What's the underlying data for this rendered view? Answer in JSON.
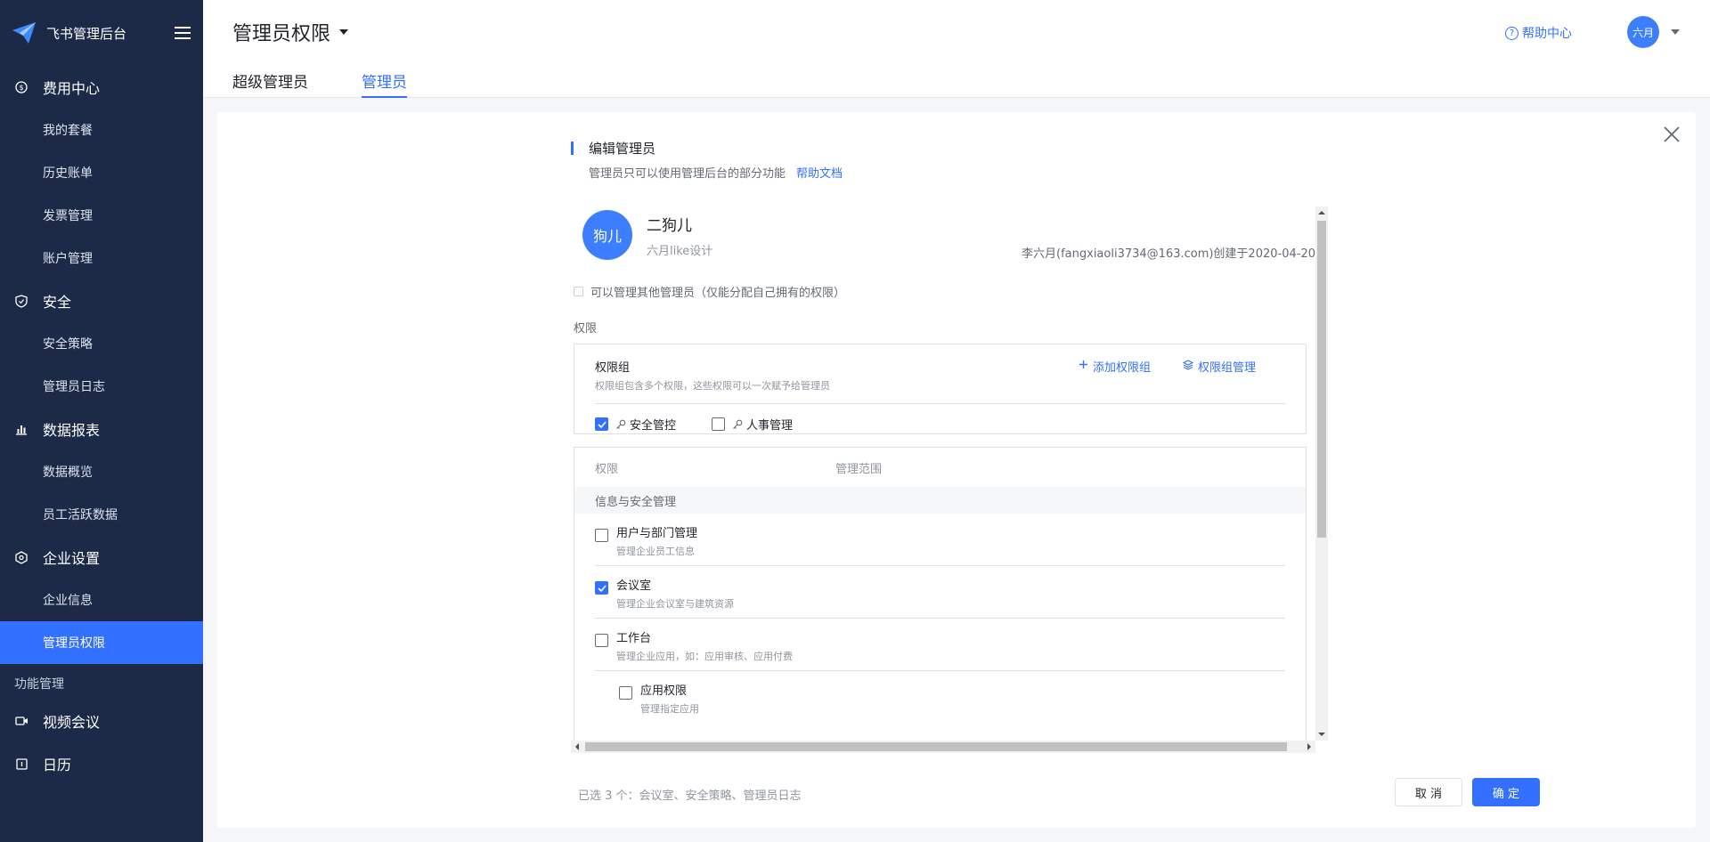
{
  "brand": {
    "name": "飞书管理后台"
  },
  "sidebar": {
    "groups": [
      {
        "label": "费用中心",
        "icon": "coin-icon",
        "items": [
          "我的套餐",
          "历史账单",
          "发票管理",
          "账户管理"
        ]
      },
      {
        "label": "安全",
        "icon": "shield-icon",
        "items": [
          "安全策略",
          "管理员日志"
        ]
      },
      {
        "label": "数据报表",
        "icon": "bar-chart-icon",
        "items": [
          "数据概览",
          "员工活跃数据"
        ]
      },
      {
        "label": "企业设置",
        "icon": "hexagon-settings-icon",
        "items": [
          "企业信息",
          "管理员权限"
        ]
      }
    ],
    "active_item": "管理员权限",
    "section_label": "功能管理",
    "feature_items": [
      {
        "label": "视频会议",
        "icon": "video-icon"
      },
      {
        "label": "日历",
        "icon": "calendar-icon"
      }
    ]
  },
  "header": {
    "title": "管理员权限",
    "tabs": [
      {
        "label": "超级管理员",
        "active": false
      },
      {
        "label": "管理员",
        "active": true
      }
    ],
    "help_label": "帮助中心",
    "user_avatar": "六月"
  },
  "editor": {
    "title": "编辑管理员",
    "description": "管理员只可以使用管理后台的部分功能",
    "help_link": "帮助文档",
    "user": {
      "avatar": "狗儿",
      "name": "二狗儿",
      "org": "六月like设计",
      "created": "李六月(fangxiaoli3734@163.com)创建于2020-04-20"
    },
    "can_manage_label": "可以管理其他管理员（仅能分配自己拥有的权限）",
    "permissions_label": "权限",
    "group": {
      "title": "权限组",
      "desc": "权限组包含多个权限，这些权限可以一次赋予给管理员",
      "add_label": "添加权限组",
      "manage_label": "权限组管理",
      "items": [
        {
          "label": "安全管控",
          "checked": true
        },
        {
          "label": "人事管理",
          "checked": false
        }
      ]
    },
    "table": {
      "col_permission": "权限",
      "col_scope": "管理范围",
      "category": "信息与安全管理",
      "rows": [
        {
          "name": "用户与部门管理",
          "desc": "管理企业员工信息",
          "checked": false
        },
        {
          "name": "会议室",
          "desc": "管理企业会议室与建筑资源",
          "checked": true
        },
        {
          "name": "工作台",
          "desc": "管理企业应用，如：应用审核、应用付费",
          "checked": false
        }
      ],
      "sub_rows": [
        {
          "name": "应用权限",
          "desc": "管理指定应用",
          "checked": false
        }
      ]
    },
    "summary": "已选 3 个：会议室、安全策略、管理员日志",
    "cancel_label": "取 消",
    "ok_label": "确 定"
  },
  "colors": {
    "primary": "#3370ff",
    "sidebar_bg": "#1c2a48"
  }
}
